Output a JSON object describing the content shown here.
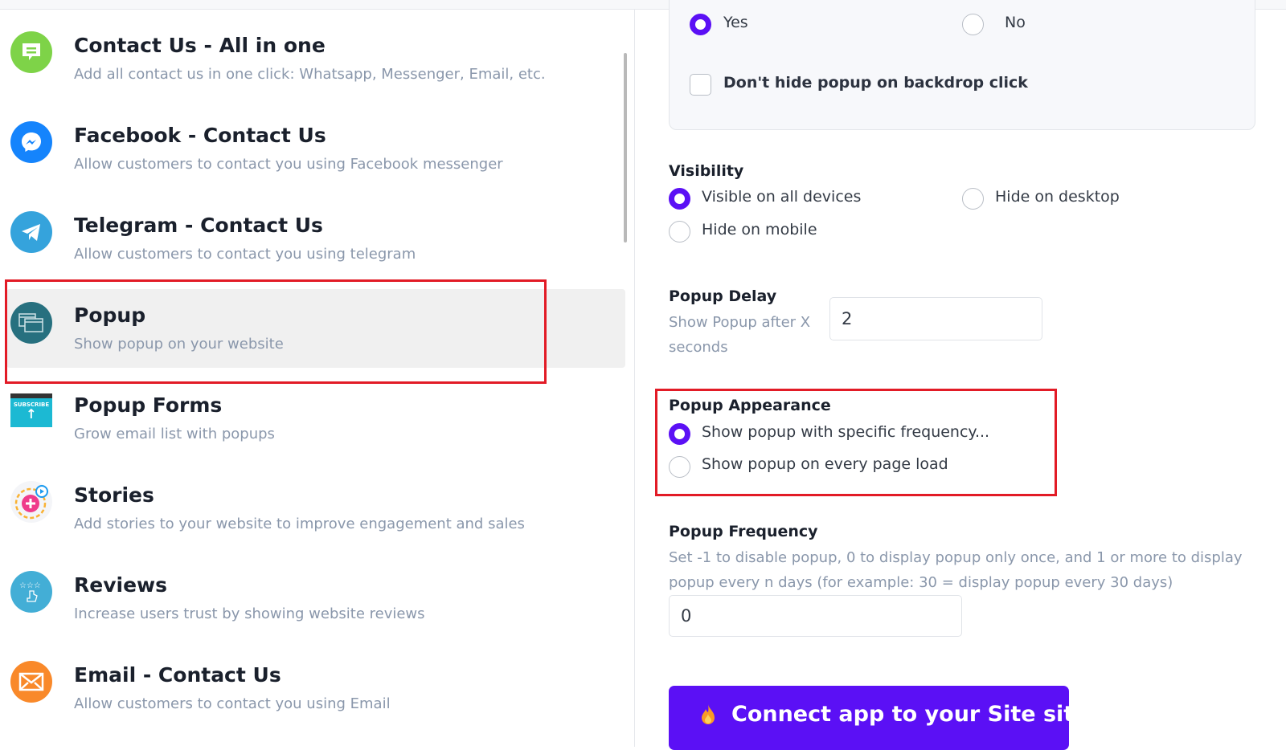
{
  "apps": [
    {
      "title": "Contact Us - All in one",
      "desc": "Add all contact us in one click: Whatsapp, Messenger, Email, etc.",
      "icon": "chat-bubble-icon",
      "color": "#7ed348"
    },
    {
      "title": "Facebook - Contact Us",
      "desc": "Allow customers to contact you using Facebook messenger",
      "icon": "messenger-icon",
      "color": "#1584fc"
    },
    {
      "title": "Telegram - Contact Us",
      "desc": "Allow customers to contact you using telegram",
      "icon": "telegram-icon",
      "color": "#35a3dc"
    },
    {
      "title": "Popup",
      "desc": "Show popup on your website",
      "icon": "popup-windows-icon",
      "color": "#27707f",
      "selected": true
    },
    {
      "title": "Popup Forms",
      "desc": "Grow email list with popups",
      "icon": "subscribe-icon",
      "color": "#1cb9d3",
      "badge": "SUBSCRIBE"
    },
    {
      "title": "Stories",
      "desc": "Add stories to your website to improve engagement and sales",
      "icon": "stories-icon",
      "color": "#ef3b8b"
    },
    {
      "title": "Reviews",
      "desc": "Increase users trust by showing website reviews",
      "icon": "reviews-icon",
      "color": "#43aed6"
    },
    {
      "title": "Email - Contact Us",
      "desc": "Allow customers to contact you using Email",
      "icon": "email-icon",
      "color": "#f9892a"
    }
  ],
  "settings": {
    "yes_label": "Yes",
    "no_label": "No",
    "yes_no_selected": "Yes",
    "backdrop_checkbox_label": "Don't hide popup on backdrop click",
    "backdrop_checked": false,
    "visibility": {
      "title": "Visibility",
      "options": [
        "Visible on all devices",
        "Hide on desktop",
        "Hide on mobile"
      ],
      "selected": "Visible on all devices"
    },
    "delay": {
      "title": "Popup Delay",
      "help": "Show Popup after X seconds",
      "value": "2"
    },
    "appearance": {
      "title": "Popup Appearance",
      "options": [
        "Show popup with specific frequency...",
        "Show popup on every page load"
      ],
      "selected": "Show popup with specific frequency..."
    },
    "frequency": {
      "title": "Popup Frequency",
      "help": "Set -1 to disable popup, 0 to display popup only once, and 1 or more to display popup every n days (for example: 30 = display popup every 30 days)",
      "value": "0"
    },
    "cta_label": "Connect app to your Site site"
  },
  "colors": {
    "accent": "#5b10f5",
    "highlight": "#e21b26"
  }
}
